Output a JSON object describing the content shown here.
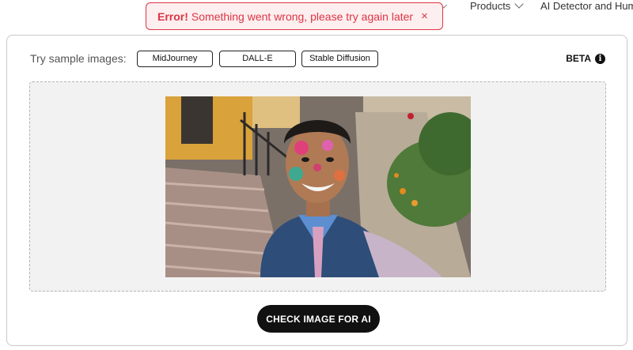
{
  "nav": {
    "products": "Products",
    "ai_detector": "AI Detector and Hum"
  },
  "toast": {
    "title": "Error!",
    "message": "Something went wrong, please try again later",
    "close": "×"
  },
  "samples": {
    "label": "Try sample images:",
    "buttons": [
      "MidJourney",
      "DALL-E",
      "Stable Diffusion"
    ]
  },
  "beta": {
    "label": "BETA",
    "info": "i"
  },
  "dropzone": {
    "photo_subject": "selfie of smiling student with colorful holi paint in school uniform"
  },
  "check_button": "CHECK IMAGE FOR AI",
  "colors": {
    "error": "#dc3545",
    "error_bg": "#fdeeef",
    "button_dark": "#111111",
    "dropzone_bg": "#f2f2f2"
  }
}
